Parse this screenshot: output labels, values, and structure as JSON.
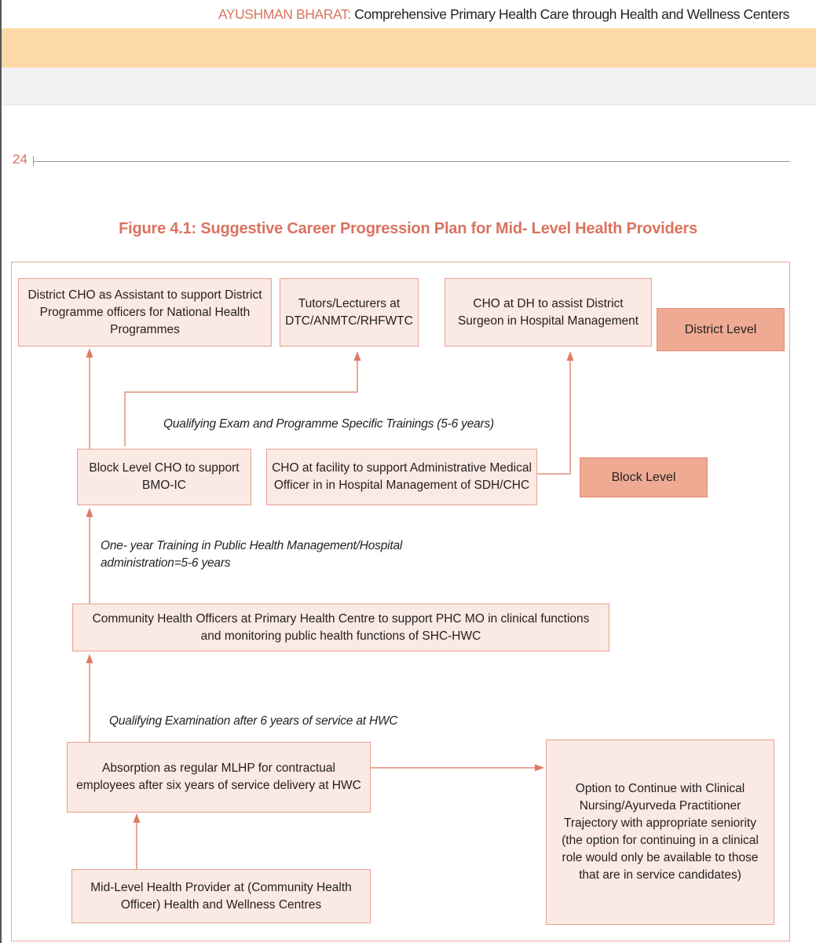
{
  "header": {
    "brand": "AYUSHMAN BHARAT:",
    "subtitle": "Comprehensive Primary Health Care through Health and Wellness Centers",
    "band_color": "#fdd9a8",
    "accent_color": "#d9735f"
  },
  "page": {
    "number": "24"
  },
  "figure": {
    "title": "Figure 4.1: Suggestive Career Progression Plan for Mid- Level Health Providers",
    "levels": {
      "district": "District Level",
      "block": "Block Level"
    },
    "nodes": {
      "district_cho_assistant": "District CHO as Assistant to support District Programme officers for National Health Programmes",
      "tutors_lecturers": "Tutors/Lecturers at DTC/ANMTC/RHFWTC",
      "cho_at_dh": "CHO at DH to assist District Surgeon in Hospital Management",
      "block_level_cho": "Block Level CHO to support BMO-IC",
      "cho_at_facility": "CHO at facility to support Administrative Medical Officer in in Hospital Management of SDH/CHC",
      "cho_at_phc": "Community Health Officers at Primary Health Centre to support PHC MO in clinical functions and monitoring public health functions of SHC-HWC",
      "absorption_mlhp": "Absorption as regular MLHP for contractual employees after six years of service delivery at HWC",
      "mlhp_at_hwc": "Mid-Level Health Provider at (Community Health Officer) Health and Wellness Centres",
      "clinical_option": "Option to Continue with Clinical Nursing/Ayurveda Practitioner Trajectory with appropriate seniority (the option for continuing in a clinical role would only be available to those that are in service candidates)"
    },
    "captions": {
      "qualifying_exam_trainings": "Qualifying Exam and Programme Specific Trainings (5-6 years)",
      "one_year_training_line1": "One- year Training in Public Health Management/Hospital",
      "one_year_training_line2": "administration=5-6 years",
      "qualifying_exam_hwc": "Qualifying Examination after 6 years of service at HWC"
    },
    "edges": [
      {
        "from": "mlhp_at_hwc",
        "to": "absorption_mlhp"
      },
      {
        "from": "absorption_mlhp",
        "to": "clinical_option"
      },
      {
        "from": "absorption_mlhp",
        "to": "cho_at_phc",
        "label": "qualifying_exam_hwc"
      },
      {
        "from": "cho_at_phc",
        "to": "block_level_cho",
        "label": "one_year_training"
      },
      {
        "from": "block_level_cho",
        "to": "district_cho_assistant"
      },
      {
        "from": "block_level_cho",
        "to": "tutors_lecturers",
        "label": "qualifying_exam_trainings"
      },
      {
        "from": "cho_at_facility",
        "to": "cho_at_dh"
      }
    ]
  }
}
